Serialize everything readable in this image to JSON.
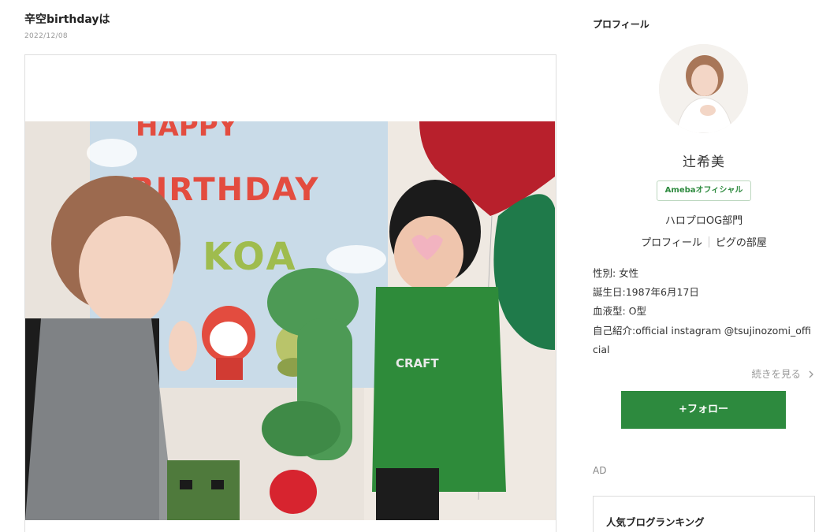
{
  "post": {
    "title": "辛空birthdayは",
    "date": "2022/12/08"
  },
  "banner": {
    "line1": "HAPPY",
    "line2": "BIRTHDAY",
    "line3": "KOA"
  },
  "shirt_text": "CRAFT",
  "sidebar": {
    "heading": "プロフィール",
    "name": "辻希美",
    "badge": "Amebaオフィシャル",
    "group": "ハロプロOG部門",
    "link_profile": "プロフィール",
    "link_room": "ピグの部屋",
    "gender": "性別: 女性",
    "birthday": "誕生日:1987年6月17日",
    "blood": "血液型: O型",
    "intro": "自己紹介:official instagram @tsujinozomi_official",
    "read_more": "続きを見る",
    "follow": "+フォロー",
    "ad": "AD",
    "ranking": "人気ブログランキング"
  },
  "colors": {
    "accent_green": "#2d8a3e",
    "banner_red": "#e34c3f",
    "banner_green": "#9fbc4e"
  }
}
